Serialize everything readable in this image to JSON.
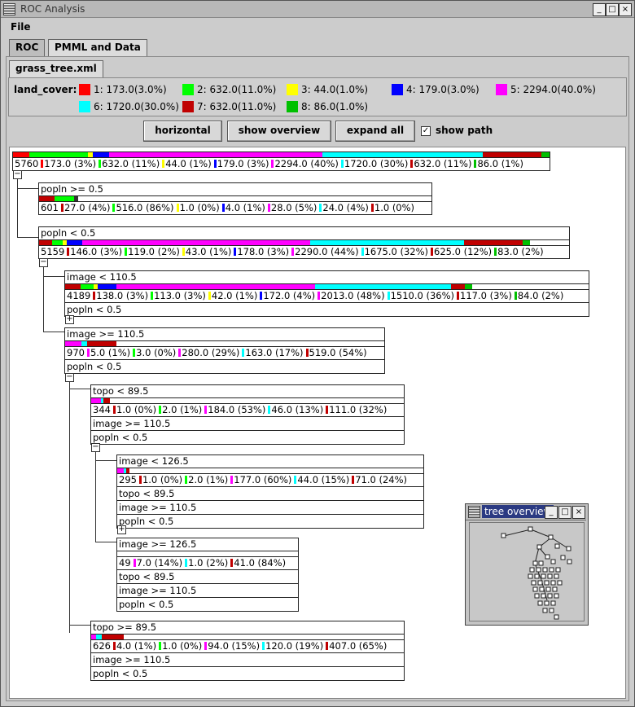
{
  "window": {
    "title": "ROC Analysis",
    "btn_min": "_",
    "btn_max": "□",
    "btn_close": "×"
  },
  "menu": {
    "file": "File"
  },
  "tabs": [
    {
      "label": "ROC"
    },
    {
      "label": "PMML and Data"
    }
  ],
  "subtab": {
    "label": "grass_tree.xml"
  },
  "legend": {
    "label": "land_cover:",
    "items": [
      {
        "text": "1: 173.0(3.0%)",
        "color": "#ff0000"
      },
      {
        "text": "2: 632.0(11.0%)",
        "color": "#00ff00"
      },
      {
        "text": "3: 44.0(1.0%)",
        "color": "#ffff00"
      },
      {
        "text": "4: 179.0(3.0%)",
        "color": "#0000ff"
      },
      {
        "text": "5: 2294.0(40.0%)",
        "color": "#ff00ff"
      },
      {
        "text": "6: 1720.0(30.0%)",
        "color": "#00ffff"
      },
      {
        "text": "7: 632.0(11.0%)",
        "color": "#c00000"
      },
      {
        "text": "8: 86.0(1.0%)",
        "color": "#00c000"
      }
    ]
  },
  "toolbar": {
    "horizontal": "horizontal",
    "show_overview": "show overview",
    "expand_all": "expand all",
    "show_path": "show path",
    "show_path_checked": "✓"
  },
  "tree": {
    "n0": {
      "count": "5760",
      "stats": [
        [
          "#ff0000",
          "173.0 (3%)"
        ],
        [
          "#00ff00",
          "632.0 (11%)"
        ],
        [
          "#ffff00",
          "44.0 (1%)"
        ],
        [
          "#0000ff",
          "179.0 (3%)"
        ],
        [
          "#ff00ff",
          "2294.0 (40%)"
        ],
        [
          "#00ffff",
          "1720.0 (30%)"
        ],
        [
          "#c00000",
          "632.0 (11%)"
        ],
        [
          "#00c000",
          "86.0 (1%)"
        ]
      ]
    },
    "n1": {
      "cond": "popln >= 0.5",
      "count": "601",
      "stats": [
        [
          "#c00000",
          "27.0 (4%)"
        ],
        [
          "#00ff00",
          "516.0 (86%)"
        ],
        [
          "#ffff00",
          "1.0 (0%)"
        ],
        [
          "#0000ff",
          "4.0 (1%)"
        ],
        [
          "#ff00ff",
          "28.0 (5%)"
        ],
        [
          "#00ffff",
          "24.0 (4%)"
        ],
        [
          "#c00000",
          "1.0 (0%)"
        ]
      ]
    },
    "n2": {
      "cond": "popln < 0.5",
      "count": "5159",
      "stats": [
        [
          "#c00000",
          "146.0 (3%)"
        ],
        [
          "#00ff00",
          "119.0 (2%)"
        ],
        [
          "#ffff00",
          "43.0 (1%)"
        ],
        [
          "#0000ff",
          "178.0 (3%)"
        ],
        [
          "#ff00ff",
          "2290.0 (44%)"
        ],
        [
          "#00ffff",
          "1675.0 (32%)"
        ],
        [
          "#c00000",
          "625.0 (12%)"
        ],
        [
          "#00c000",
          "83.0 (2%)"
        ]
      ]
    },
    "n3": {
      "cond": "image < 110.5",
      "count": "4189",
      "stats": [
        [
          "#c00000",
          "138.0 (3%)"
        ],
        [
          "#00ff00",
          "113.0 (3%)"
        ],
        [
          "#ffff00",
          "42.0 (1%)"
        ],
        [
          "#0000ff",
          "172.0 (4%)"
        ],
        [
          "#ff00ff",
          "2013.0 (48%)"
        ],
        [
          "#00ffff",
          "1510.0 (36%)"
        ],
        [
          "#c00000",
          "117.0 (3%)"
        ],
        [
          "#00c000",
          "84.0 (2%)"
        ]
      ],
      "path": [
        "popln < 0.5"
      ]
    },
    "n4": {
      "cond": "image >= 110.5",
      "count": "970",
      "stats": [
        [
          "#ff00ff",
          "5.0 (1%)"
        ],
        [
          "#00ff00",
          "3.0 (0%)"
        ],
        [
          "#ff00ff",
          "280.0 (29%)"
        ],
        [
          "#00ffff",
          "163.0 (17%)"
        ],
        [
          "#c00000",
          "519.0 (54%)"
        ]
      ],
      "path": [
        "popln < 0.5"
      ]
    },
    "n5": {
      "cond": "topo < 89.5",
      "count": "344",
      "stats": [
        [
          "#c00000",
          "1.0 (0%)"
        ],
        [
          "#00ff00",
          "2.0 (1%)"
        ],
        [
          "#ff00ff",
          "184.0 (53%)"
        ],
        [
          "#00ffff",
          "46.0 (13%)"
        ],
        [
          "#c00000",
          "111.0 (32%)"
        ]
      ],
      "path": [
        "image >= 110.5",
        "popln < 0.5"
      ]
    },
    "n6": {
      "cond": "image < 126.5",
      "count": "295",
      "stats": [
        [
          "#c00000",
          "1.0 (0%)"
        ],
        [
          "#00ff00",
          "2.0 (1%)"
        ],
        [
          "#ff00ff",
          "177.0 (60%)"
        ],
        [
          "#00ffff",
          "44.0 (15%)"
        ],
        [
          "#c00000",
          "71.0 (24%)"
        ]
      ],
      "path": [
        "topo < 89.5",
        "image >= 110.5",
        "popln < 0.5"
      ]
    },
    "n7": {
      "cond": "image >= 126.5",
      "count": "49",
      "stats": [
        [
          "#ff00ff",
          "7.0 (14%)"
        ],
        [
          "#00ffff",
          "1.0 (2%)"
        ],
        [
          "#c00000",
          "41.0 (84%)"
        ]
      ],
      "path": [
        "topo < 89.5",
        "image >= 110.5",
        "popln < 0.5"
      ]
    },
    "n8": {
      "cond": "topo >= 89.5",
      "count": "626",
      "stats": [
        [
          "#c00000",
          "4.0 (1%)"
        ],
        [
          "#00ff00",
          "1.0 (0%)"
        ],
        [
          "#ff00ff",
          "94.0 (15%)"
        ],
        [
          "#00ffff",
          "120.0 (19%)"
        ],
        [
          "#c00000",
          "407.0 (65%)"
        ]
      ],
      "path": [
        "image >= 110.5",
        "popln < 0.5"
      ]
    }
  },
  "overview": {
    "title": "tree overview"
  }
}
